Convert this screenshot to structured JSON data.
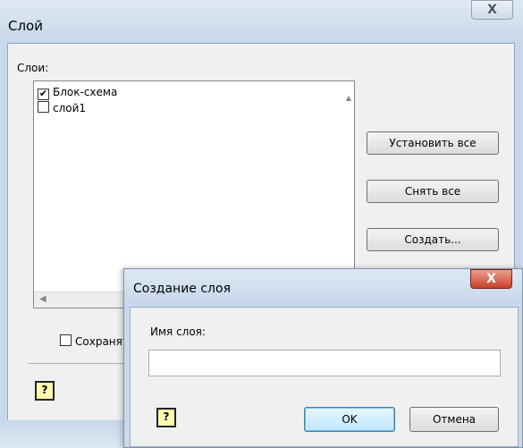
{
  "main_dialog": {
    "title": "Слой",
    "layers_label": "Слои:",
    "layers": [
      {
        "name": "Блок-схема",
        "checked": true
      },
      {
        "name": "слой1",
        "checked": false
      }
    ],
    "buttons": {
      "set_all": "Установить все",
      "clear_all": "Снять все",
      "create": "Создать..."
    },
    "save_checkbox_label": "Сохранят",
    "close_glyph": "X",
    "help_glyph": "?"
  },
  "create_dialog": {
    "title": "Создание слоя",
    "name_label": "Имя слоя:",
    "name_value": "",
    "ok_label": "OK",
    "cancel_label": "Отмена",
    "close_glyph": "X",
    "help_glyph": "?"
  },
  "icons": {
    "check": "✔",
    "scroll_up": "▲",
    "scroll_left": "◀"
  }
}
